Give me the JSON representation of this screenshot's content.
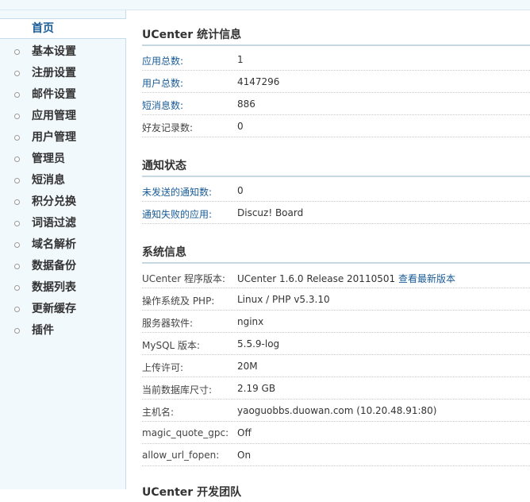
{
  "sidebar": {
    "items": [
      {
        "label": "首页",
        "active": true
      },
      {
        "label": "基本设置"
      },
      {
        "label": "注册设置"
      },
      {
        "label": "邮件设置"
      },
      {
        "label": "应用管理"
      },
      {
        "label": "用户管理"
      },
      {
        "label": "管理员"
      },
      {
        "label": "短消息"
      },
      {
        "label": "积分兑换"
      },
      {
        "label": "词语过滤"
      },
      {
        "label": "域名解析"
      },
      {
        "label": "数据备份"
      },
      {
        "label": "数据列表"
      },
      {
        "label": "更新缓存"
      },
      {
        "label": "插件"
      }
    ]
  },
  "stats": {
    "title": "UCenter 统计信息",
    "rows": [
      {
        "key": "应用总数:",
        "value": "1"
      },
      {
        "key": "用户总数:",
        "value": "4147296"
      },
      {
        "key": "短消息数:",
        "value": "886"
      },
      {
        "key": "好友记录数:",
        "value": "0"
      }
    ]
  },
  "notify": {
    "title": "通知状态",
    "rows": [
      {
        "key": "未发送的通知数:",
        "value": "0"
      },
      {
        "key": "通知失败的应用:",
        "value": "Discuz! Board"
      }
    ]
  },
  "system": {
    "title": "系统信息",
    "rows": [
      {
        "key": "UCenter 程序版本:",
        "value": "UCenter 1.6.0 Release 20110501",
        "link": "查看最新版本"
      },
      {
        "key": "操作系统及 PHP:",
        "value": "Linux / PHP v5.3.10"
      },
      {
        "key": "服务器软件:",
        "value": "nginx"
      },
      {
        "key": "MySQL 版本:",
        "value": "5.5.9-log"
      },
      {
        "key": "上传许可:",
        "value": "20M"
      },
      {
        "key": "当前数据库尺寸:",
        "value": "2.19 GB"
      },
      {
        "key": "主机名:",
        "value": "yaoguobbs.duowan.com (10.20.48.91:80)"
      },
      {
        "key": "magic_quote_gpc:",
        "value": "Off"
      },
      {
        "key": "allow_url_fopen:",
        "value": "On"
      }
    ]
  },
  "team": {
    "title": "UCenter 开发团队"
  },
  "colors": {
    "link": "#1a5c97",
    "sidebar_bg": "#f2f9fd",
    "section_rule": "#c6d9e3"
  }
}
